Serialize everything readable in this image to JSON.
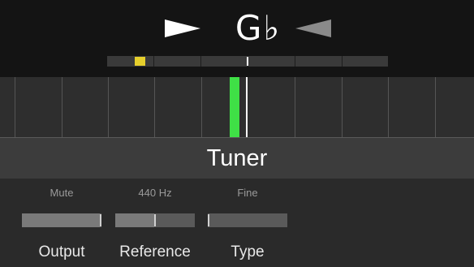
{
  "tuner": {
    "note": "G♭",
    "title": "Tuner"
  },
  "colors": {
    "in_tune_bar": "#3fe046",
    "coarse_marker": "#e6cf2c",
    "arrow_active": "#ffffff",
    "arrow_inactive": "#8a8a8a"
  },
  "params": [
    {
      "name": "Output",
      "value": "Mute",
      "level": 1.0
    },
    {
      "name": "Reference",
      "value": "440 Hz",
      "level": 0.5
    },
    {
      "name": "Type",
      "value": "Fine",
      "level": 0.0
    }
  ]
}
